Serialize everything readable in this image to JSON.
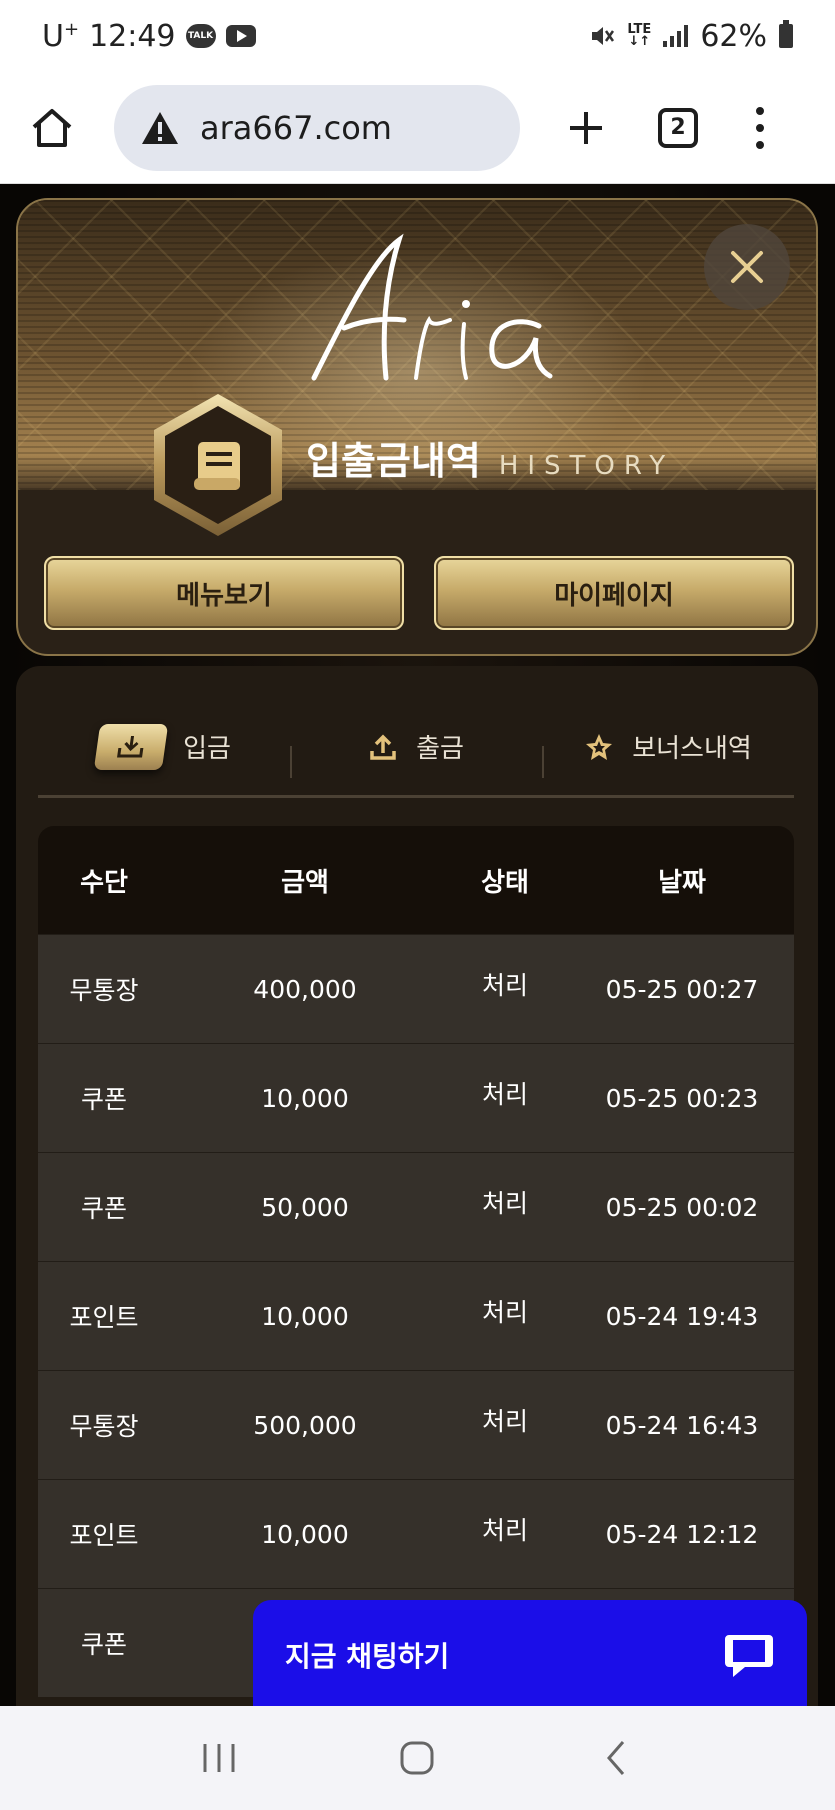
{
  "status_bar": {
    "carrier": "U",
    "carrier_sup": "+",
    "time": "12:49",
    "talk_badge": "TALK",
    "lte": "LTE",
    "battery": "62%"
  },
  "browser": {
    "url": "ara667.com",
    "tab_count": "2"
  },
  "header": {
    "title_ko": "입출금내역",
    "title_en": "HISTORY",
    "menu_button": "메뉴보기",
    "mypage_button": "마이페이지"
  },
  "tabs": [
    {
      "label": "입금",
      "icon": "download-icon",
      "active": true
    },
    {
      "label": "출금",
      "icon": "upload-icon",
      "active": false
    },
    {
      "label": "보너스내역",
      "icon": "star-icon",
      "active": false
    }
  ],
  "table": {
    "columns": [
      "수단",
      "금액",
      "상태",
      "날짜"
    ],
    "rows": [
      [
        "무통장",
        "400,000",
        "처리",
        "05-25 00:27"
      ],
      [
        "쿠폰",
        "10,000",
        "처리",
        "05-25 00:23"
      ],
      [
        "쿠폰",
        "50,000",
        "처리",
        "05-25 00:02"
      ],
      [
        "포인트",
        "10,000",
        "처리",
        "05-24 19:43"
      ],
      [
        "무통장",
        "500,000",
        "처리",
        "05-24 16:43"
      ],
      [
        "포인트",
        "10,000",
        "처리",
        "05-24 12:12"
      ],
      [
        "쿠폰",
        "",
        "",
        ""
      ]
    ]
  },
  "chat": {
    "label": "지금 채팅하기"
  },
  "colors": {
    "gold": "#c7ab6a",
    "chat_blue": "#1b0ee8",
    "row_bg": "#35302a"
  }
}
